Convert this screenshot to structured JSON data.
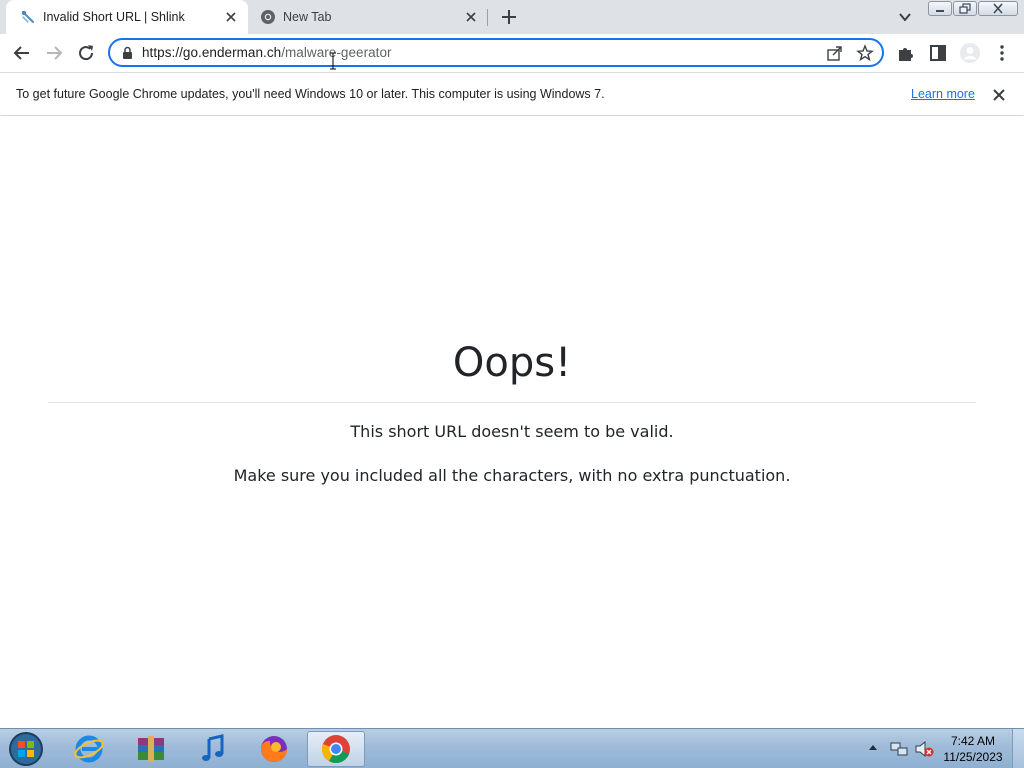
{
  "tabs": [
    {
      "title": "Invalid Short URL | Shlink",
      "icon": "shlink-icon",
      "active": true
    },
    {
      "title": "New Tab",
      "icon": "chrome-icon",
      "active": false
    }
  ],
  "address_bar": {
    "host": "https://go.enderman.ch",
    "path": "/malware-geerator"
  },
  "infobar": {
    "message": "To get future Google Chrome updates, you'll need Windows 10 or later. This computer is using Windows 7.",
    "link": "Learn more"
  },
  "page": {
    "heading": "Oops!",
    "line1": "This short URL doesn't seem to be valid.",
    "line2": "Make sure you included all the characters, with no extra punctuation."
  },
  "taskbar": {
    "apps": [
      "internet-explorer-icon",
      "winrar-icon",
      "itunes-icon",
      "firefox-icon",
      "chrome-icon"
    ],
    "active_app": "chrome-icon",
    "time": "7:42 AM",
    "date": "11/25/2023"
  },
  "colors": {
    "accent": "#1a73e8",
    "tabstrip": "#dee1e6",
    "text": "#212529"
  }
}
